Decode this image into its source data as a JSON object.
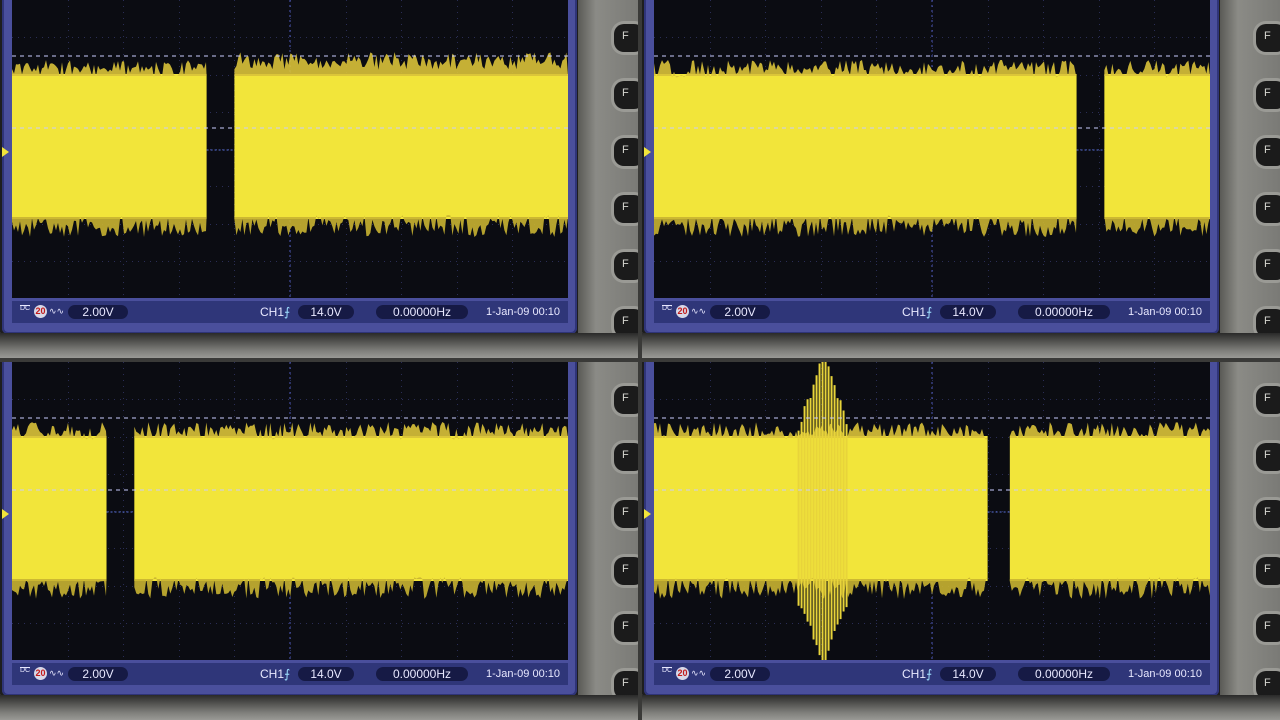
{
  "status": {
    "coupling": "DC",
    "bw_limit": "20",
    "invert": "∿∿",
    "volts_div": "2.00V",
    "trigger_source": "CH1",
    "trigger_slope": "⨍",
    "trigger_level": "14.0V",
    "frequency": "0.00000Hz",
    "datetime": "1-Jan-09 00:10"
  },
  "side_buttons": [
    "F",
    "F",
    "F",
    "F",
    "F",
    "F"
  ],
  "colors": {
    "trace": "#f2e53a",
    "screen": "#0b0c12",
    "bezel": "#4a4f9c",
    "status_bar": "#2f3679"
  },
  "panels": [
    {
      "name": "panel-1",
      "gaps": [
        [
          0.35,
          0.4
        ]
      ],
      "spikes": []
    },
    {
      "name": "panel-2",
      "gaps": [
        [
          0.76,
          0.81
        ]
      ],
      "spikes": []
    },
    {
      "name": "panel-3",
      "gaps": [
        [
          0.17,
          0.22
        ]
      ],
      "spikes": []
    },
    {
      "name": "panel-4",
      "gaps": [
        [
          0.6,
          0.64
        ]
      ],
      "spikes": [
        [
          0.26,
          0.35
        ]
      ]
    }
  ]
}
